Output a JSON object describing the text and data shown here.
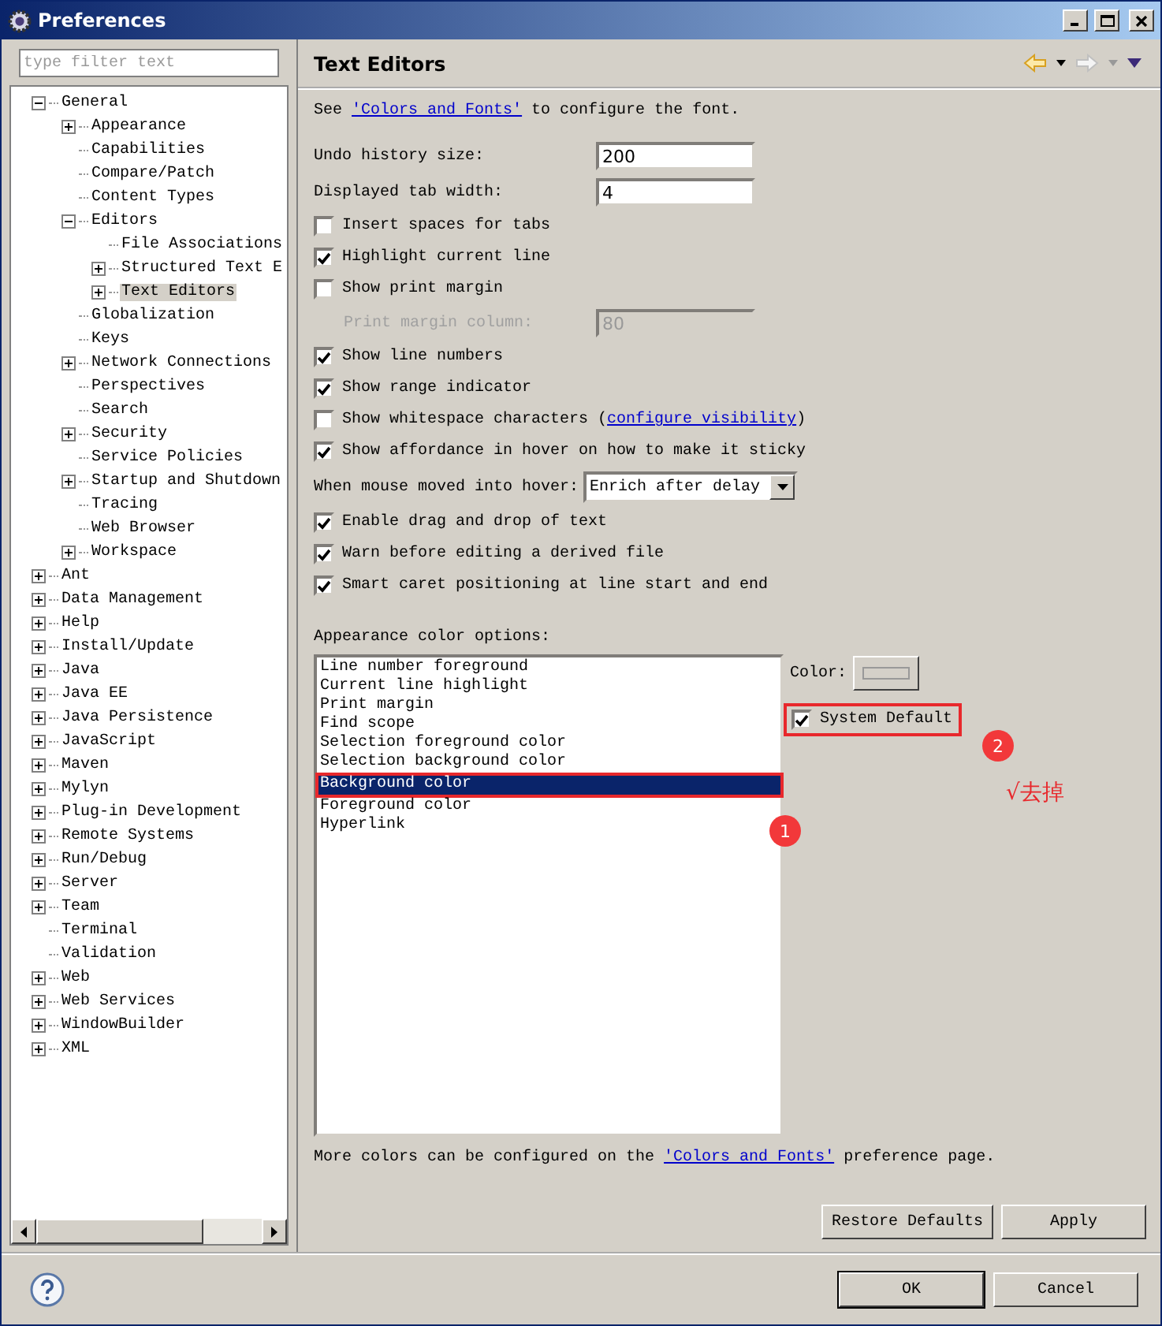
{
  "window": {
    "title": "Preferences"
  },
  "filter": {
    "placeholder": "type filter text"
  },
  "tree": [
    {
      "label": "General",
      "kind": "group",
      "expanded": true,
      "selected": false,
      "children": [
        {
          "label": "Appearance",
          "kind": "group",
          "expanded": false,
          "selected": false
        },
        {
          "label": "Capabilities",
          "kind": "page",
          "selected": false
        },
        {
          "label": "Compare/Patch",
          "kind": "page",
          "selected": false
        },
        {
          "label": "Content Types",
          "kind": "page",
          "selected": false
        },
        {
          "label": "Editors",
          "kind": "group",
          "expanded": true,
          "selected": false,
          "children": [
            {
              "label": "File Associations",
              "kind": "page",
              "selected": false
            },
            {
              "label": "Structured Text E",
              "kind": "group",
              "expanded": false,
              "selected": false
            },
            {
              "label": "Text Editors",
              "kind": "group",
              "expanded": false,
              "selected": true
            }
          ]
        },
        {
          "label": "Globalization",
          "kind": "page",
          "selected": false
        },
        {
          "label": "Keys",
          "kind": "page",
          "selected": false
        },
        {
          "label": "Network Connections",
          "kind": "group",
          "expanded": false,
          "selected": false
        },
        {
          "label": "Perspectives",
          "kind": "page",
          "selected": false
        },
        {
          "label": "Search",
          "kind": "page",
          "selected": false
        },
        {
          "label": "Security",
          "kind": "group",
          "expanded": false,
          "selected": false
        },
        {
          "label": "Service Policies",
          "kind": "page",
          "selected": false
        },
        {
          "label": "Startup and Shutdown",
          "kind": "group",
          "expanded": false,
          "selected": false
        },
        {
          "label": "Tracing",
          "kind": "page",
          "selected": false
        },
        {
          "label": "Web Browser",
          "kind": "page",
          "selected": false
        },
        {
          "label": "Workspace",
          "kind": "group",
          "expanded": false,
          "selected": false
        }
      ]
    },
    {
      "label": "Ant",
      "kind": "group",
      "expanded": false,
      "selected": false
    },
    {
      "label": "Data Management",
      "kind": "group",
      "expanded": false,
      "selected": false
    },
    {
      "label": "Help",
      "kind": "group",
      "expanded": false,
      "selected": false
    },
    {
      "label": "Install/Update",
      "kind": "group",
      "expanded": false,
      "selected": false
    },
    {
      "label": "Java",
      "kind": "group",
      "expanded": false,
      "selected": false
    },
    {
      "label": "Java EE",
      "kind": "group",
      "expanded": false,
      "selected": false
    },
    {
      "label": "Java Persistence",
      "kind": "group",
      "expanded": false,
      "selected": false
    },
    {
      "label": "JavaScript",
      "kind": "group",
      "expanded": false,
      "selected": false
    },
    {
      "label": "Maven",
      "kind": "group",
      "expanded": false,
      "selected": false
    },
    {
      "label": "Mylyn",
      "kind": "group",
      "expanded": false,
      "selected": false
    },
    {
      "label": "Plug-in Development",
      "kind": "group",
      "expanded": false,
      "selected": false
    },
    {
      "label": "Remote Systems",
      "kind": "group",
      "expanded": false,
      "selected": false
    },
    {
      "label": "Run/Debug",
      "kind": "group",
      "expanded": false,
      "selected": false
    },
    {
      "label": "Server",
      "kind": "group",
      "expanded": false,
      "selected": false
    },
    {
      "label": "Team",
      "kind": "group",
      "expanded": false,
      "selected": false
    },
    {
      "label": "Terminal",
      "kind": "page",
      "selected": false
    },
    {
      "label": "Validation",
      "kind": "page",
      "selected": false
    },
    {
      "label": "Web",
      "kind": "group",
      "expanded": false,
      "selected": false
    },
    {
      "label": "Web Services",
      "kind": "group",
      "expanded": false,
      "selected": false
    },
    {
      "label": "WindowBuilder",
      "kind": "group",
      "expanded": false,
      "selected": false
    },
    {
      "label": "XML",
      "kind": "group",
      "expanded": false,
      "selected": false
    }
  ],
  "page": {
    "title": "Text Editors",
    "intro": {
      "before": "See ",
      "link": "'Colors and Fonts'",
      "after": " to configure the font."
    },
    "settings": [
      {
        "kind": "field",
        "label": "Undo history size:",
        "value": "200",
        "disabled": false
      },
      {
        "kind": "field",
        "label": "Displayed tab width:",
        "value": "4",
        "disabled": false
      },
      {
        "kind": "checkbox",
        "label": "Insert spaces for tabs",
        "checked": false
      },
      {
        "kind": "checkbox",
        "label": "Highlight current line",
        "checked": true
      },
      {
        "kind": "checkbox",
        "label": "Show print margin",
        "checked": false
      },
      {
        "kind": "field",
        "label": "Print margin column:",
        "value": "80",
        "disabled": true
      },
      {
        "kind": "checkbox",
        "label": "Show line numbers",
        "checked": true
      },
      {
        "kind": "checkbox",
        "label": "Show range indicator",
        "checked": true
      },
      {
        "kind": "checkbox",
        "label": "Show whitespace characters (",
        "link": "configure visibility",
        "after": ")",
        "checked": false
      },
      {
        "kind": "checkbox",
        "label": "Show affordance in hover on how to make it sticky",
        "checked": true
      },
      {
        "kind": "dropdown",
        "label": "When mouse moved into hover:",
        "value": "Enrich after delay"
      },
      {
        "kind": "checkbox",
        "label": "Enable drag and drop of text",
        "checked": true
      },
      {
        "kind": "checkbox",
        "label": "Warn before editing a derived file",
        "checked": true
      },
      {
        "kind": "checkbox",
        "label": "Smart caret positioning at line start and end",
        "checked": true
      }
    ],
    "color_options": {
      "label": "Appearance color options:",
      "items": [
        {
          "label": "Line number foreground",
          "selected": false
        },
        {
          "label": "Current line highlight",
          "selected": false
        },
        {
          "label": "Print margin",
          "selected": false
        },
        {
          "label": "Find scope",
          "selected": false
        },
        {
          "label": "Selection foreground color",
          "selected": false
        },
        {
          "label": "Selection background color",
          "selected": false
        },
        {
          "label": "Background color",
          "selected": true
        },
        {
          "label": "Foreground color",
          "selected": false
        },
        {
          "label": "Hyperlink",
          "selected": false
        }
      ],
      "color_label": "Color:",
      "system_default": {
        "label": "System Default",
        "checked": true
      }
    },
    "footer": {
      "before": "More colors can be configured on the ",
      "link": "'Colors and Fonts'",
      "after": " preference page."
    },
    "buttons": [
      "Restore Defaults",
      "Apply"
    ]
  },
  "annotations": {
    "list_badge": "1",
    "checkbox_badge": "2",
    "note": "√去掉"
  },
  "dialog_buttons": [
    "OK",
    "Cancel"
  ]
}
